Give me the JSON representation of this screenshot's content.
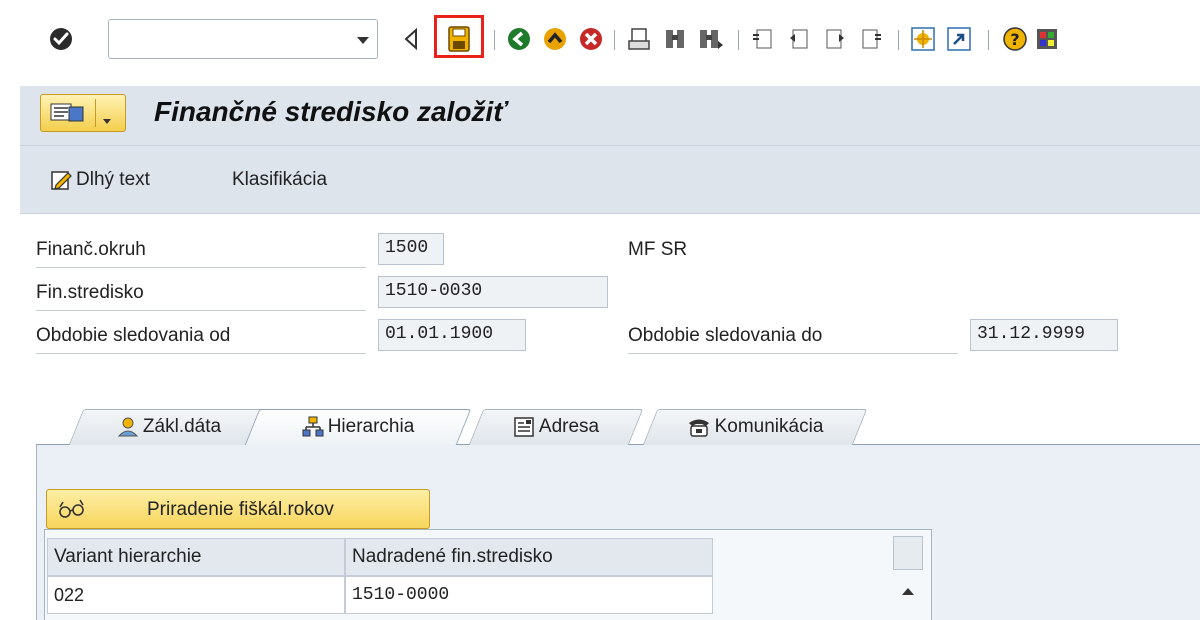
{
  "toolbar": {
    "icons": [
      "enter-icon",
      "back-nav-icon",
      "save-icon",
      "back-icon",
      "exit-icon",
      "cancel-icon",
      "print-icon",
      "find-icon",
      "find-next-icon",
      "first-page-icon",
      "previous-page-icon",
      "next-page-icon",
      "last-page-icon",
      "create-session-icon",
      "shortcut-icon",
      "help-icon",
      "layout-menu-icon"
    ],
    "command_field": {
      "value": ""
    },
    "highlight_color": "#e8221b"
  },
  "header": {
    "title": "Finančné stredisko založiť",
    "app_buttons": [
      {
        "label": "Dlhý text",
        "icon": "edit-text-icon"
      },
      {
        "label": "Klasifikácia"
      }
    ]
  },
  "form": {
    "fin_area": {
      "label": "Finanč.okruh",
      "value": "1500",
      "description": "MF SR"
    },
    "fund_center": {
      "label": "Fin.stredisko",
      "value": "1510-0030"
    },
    "valid_from": {
      "label": "Obdobie sledovania od",
      "value": "01.01.1900"
    },
    "valid_to": {
      "label": "Obdobie sledovania do",
      "value": "31.12.9999"
    }
  },
  "tabs": [
    {
      "label": "Zákl.dáta",
      "icon": "person-icon",
      "active": false
    },
    {
      "label": "Hierarchia",
      "icon": "hierarchy-icon",
      "active": true
    },
    {
      "label": "Adresa",
      "icon": "address-icon",
      "active": false
    },
    {
      "label": "Komunikácia",
      "icon": "telephone-icon",
      "active": false
    }
  ],
  "panel": {
    "assign_button": {
      "label": "Priradenie fiškál.rokov",
      "icon": "glasses-icon"
    },
    "table": {
      "columns": [
        "Variant hierarchie",
        "Nadradené fin.stredisko"
      ],
      "rows": [
        [
          "022",
          "1510-0000"
        ]
      ]
    }
  }
}
